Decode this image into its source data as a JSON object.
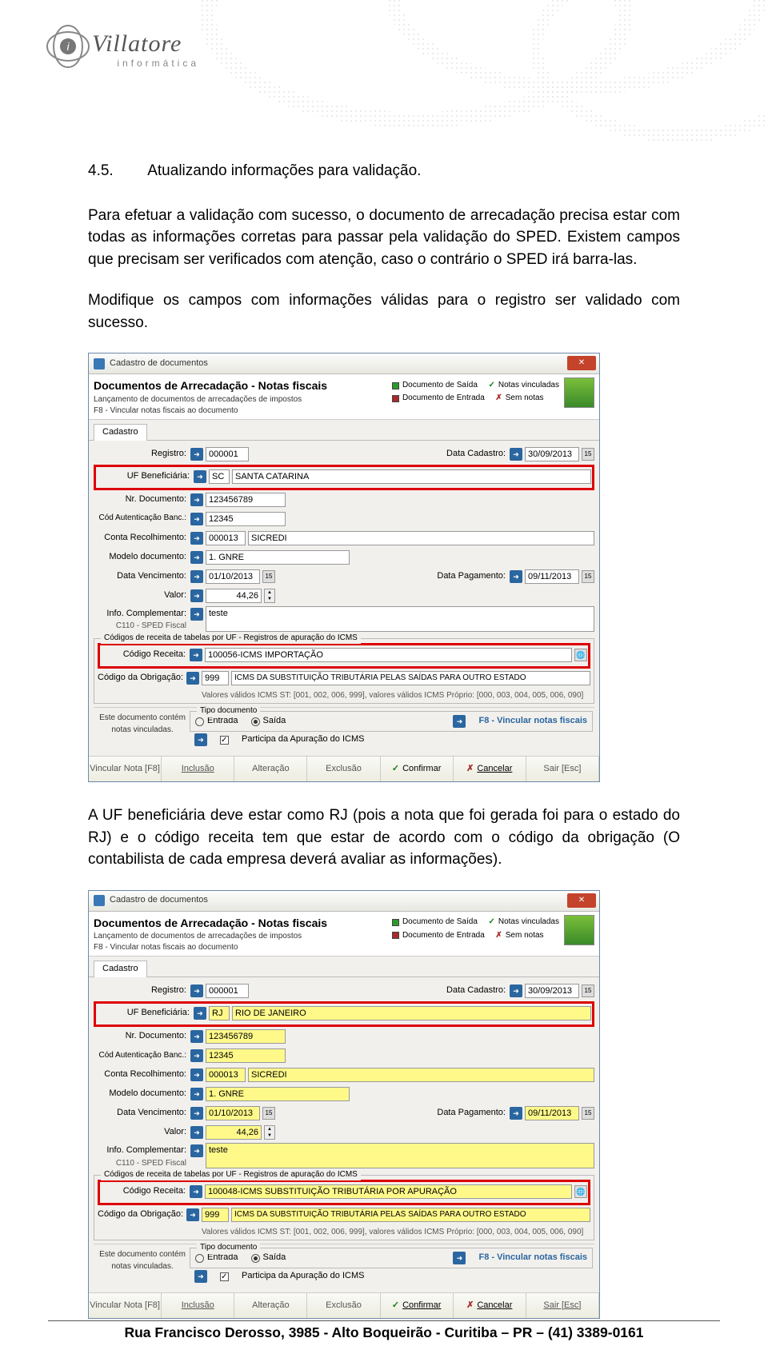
{
  "logo": {
    "brand": "Villatore",
    "sub": "informática"
  },
  "section": {
    "num": "4.5.",
    "title": "Atualizando informações para validação."
  },
  "para1": "Para efetuar a validação com sucesso, o documento de arrecadação precisa estar com todas as informações corretas para passar pela validação do SPED. Existem campos que precisam ser verificados com atenção, caso o contrário o SPED irá barra-las.",
  "para2": "Modifique os campos com informações válidas para o registro ser validado com sucesso.",
  "para3": "A UF beneficiária deve estar como RJ (pois a nota que foi gerada foi para o estado do RJ) e o código receita tem que estar de acordo com o código da obrigação (O contabilista de cada empresa deverá avaliar as informações).",
  "win": {
    "title": "Cadastro de documentos",
    "h2": "Documentos de Arrecadação - Notas fiscais",
    "sub1": "Lançamento de documentos de arrecadações de impostos",
    "sub2": "F8 - Vincular notas fiscais ao documento",
    "legend_saida": "Documento de Saída",
    "legend_entrada": "Documento de Entrada",
    "legend_vinc": "Notas vinculadas",
    "legend_sem": "Sem notas",
    "tab": "Cadastro",
    "lbl_registro": "Registro:",
    "lbl_datacad": "Data Cadastro:",
    "lbl_uf": "UF Beneficiária:",
    "lbl_nrdoc": "Nr. Documento:",
    "lbl_codaut": "Cód Autenticação Banc.:",
    "lbl_contarec": "Conta Recolhimento:",
    "lbl_modelo": "Modelo documento:",
    "lbl_datavenc": "Data Vencimento:",
    "lbl_datapag": "Data Pagamento:",
    "lbl_valor": "Valor:",
    "lbl_info": "Info. Complementar:",
    "lbl_c110": "C110 - SPED Fiscal",
    "group_title": "Códigos de receita de tabelas por UF - Registros de apuração do ICMS",
    "lbl_codrec": "Código Receita:",
    "lbl_codobr": "Código da Obrigação:",
    "valores_validos": "Valores válidos ICMS ST: [001, 002, 006, 999], valores válidos ICMS Próprio: [000, 003, 004, 005, 006, 090]",
    "leftnote": "Este documento contém notas vinculadas.",
    "tipodoc_title": "Tipo documento",
    "radio_entrada": "Entrada",
    "radio_saida": "Saída",
    "link_f8": "F8 - Vincular notas fiscais",
    "checkbox_part": "Participa da Apuração do ICMS",
    "btn_vinc": "Vincular Nota [F8]",
    "btn_incl": "Inclusão",
    "btn_alt": "Alteração",
    "btn_excl": "Exclusão",
    "btn_conf": "Confirmar",
    "btn_canc": "Cancelar",
    "btn_sair": "Sair [Esc]"
  },
  "shot1": {
    "registro": "000001",
    "datacad": "30/09/2013",
    "uf_code": "SC",
    "uf_name": "SANTA CATARINA",
    "nrdoc": "123456789",
    "codaut": "12345",
    "contarec_code": "000013",
    "contarec_name": "SICREDI",
    "modelo": "1. GNRE",
    "datavenc": "01/10/2013",
    "datapag": "09/11/2013",
    "valor": "44,26",
    "info": "teste",
    "codrec_code": "100056",
    "codrec_name": "ICMS IMPORTAÇÃO",
    "codobr_code": "999",
    "codobr_name": "ICMS DA SUBSTITUIÇÃO TRIBUTÁRIA PELAS SAÍDAS PARA OUTRO ESTADO"
  },
  "shot2": {
    "registro": "000001",
    "datacad": "30/09/2013",
    "uf_code": "RJ",
    "uf_name": "RIO DE JANEIRO",
    "nrdoc": "123456789",
    "codaut": "12345",
    "contarec_code": "000013",
    "contarec_name": "SICREDI",
    "modelo": "1. GNRE",
    "datavenc": "01/10/2013",
    "datapag": "09/11/2013",
    "valor": "44,26",
    "info": "teste",
    "codrec_code": "100048",
    "codrec_name": "ICMS SUBSTITUIÇÃO TRIBUTÁRIA POR APURAÇÃO",
    "codobr_code": "999",
    "codobr_name": "ICMS DA SUBSTITUIÇÃO TRIBUTÁRIA PELAS SAÍDAS PARA OUTRO ESTADO"
  },
  "footer": "Rua Francisco Derosso, 3985  - Alto Boqueirão - Curitiba – PR  – (41) 3389-0161"
}
